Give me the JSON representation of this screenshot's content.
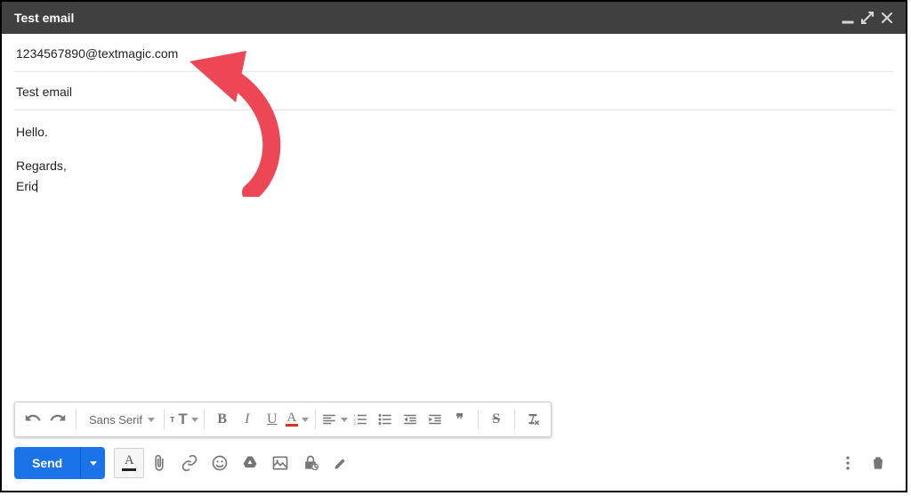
{
  "titlebar": {
    "title": "Test email"
  },
  "fields": {
    "to": "1234567890@textmagic.com",
    "subject": "Test email"
  },
  "body": {
    "line1": "Hello.",
    "line2": "Regards,",
    "line3": "Eric"
  },
  "format_toolbar": {
    "font": "Sans Serif",
    "size_label": "T",
    "bold": "B",
    "italic": "I",
    "underline": "U",
    "textcolor": "A",
    "quote": "❞",
    "strike": "S"
  },
  "actions": {
    "send": "Send",
    "format_toggle": "A"
  }
}
